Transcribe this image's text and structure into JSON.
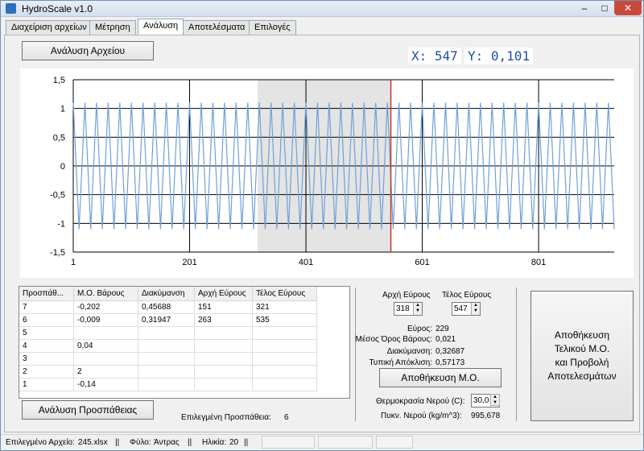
{
  "window": {
    "title": "HydroScale v1.0",
    "min": "–",
    "max": "□",
    "close": "✕"
  },
  "tabs": [
    "Διαχείριση αρχείων",
    "Μέτρηση",
    "Ανάλυση",
    "Αποτελέσματα",
    "Επιλογές"
  ],
  "active_tab": "Ανάλυση",
  "analyze_file_button": "Ανάλυση Αρχείου",
  "coords": {
    "x_label": "X:",
    "x_value": "547",
    "y_label": "Y:",
    "y_value": "0,101"
  },
  "chart_data": {
    "type": "line",
    "x_ticks": [
      "1",
      "201",
      "401",
      "601",
      "801"
    ],
    "y_ticks": [
      "1,5",
      "1",
      "0,5",
      "0",
      "-0,5",
      "-1",
      "-1,5"
    ],
    "xlim": [
      1,
      931
    ],
    "ylim": [
      -1.5,
      1.5
    ],
    "series": [
      {
        "color": "#6fa0d8",
        "amplitude": 1.1,
        "period_samples": 20
      }
    ],
    "selection_range": [
      318,
      547
    ],
    "cursor_x": 547,
    "grid": true
  },
  "table": {
    "headers": [
      "Προσπάθ...",
      "Μ.Ο. Βάρους",
      "Διακύμανση",
      "Αρχή Εύρους",
      "Τέλος Εύρους"
    ],
    "rows": [
      [
        "7",
        "-0,202",
        "0,45688",
        "151",
        "321"
      ],
      [
        "6",
        "-0,009",
        "0,31947",
        "263",
        "535"
      ],
      [
        "5",
        "",
        "",
        "",
        ""
      ],
      [
        "4",
        "0,04",
        "",
        "",
        ""
      ],
      [
        "3",
        "",
        "",
        "",
        ""
      ],
      [
        "2",
        "2",
        "",
        "",
        ""
      ],
      [
        "1",
        "-0,14",
        "",
        "",
        ""
      ]
    ]
  },
  "analyze_attempt_button": "Ανάλυση Προσπάθειας",
  "selected_attempt": {
    "label": "Επιλεγμένη Προσπάθεια:",
    "value": "6"
  },
  "range": {
    "start_label": "Αρχή Εύρους",
    "end_label": "Τέλος Εύρους",
    "start": "318",
    "end": "547"
  },
  "stats": {
    "range_label": "Εύρος:",
    "range_value": "229",
    "mean_label": "Μέσος Όρος Βάρους:",
    "mean_value": "0,021",
    "var_label": "Διακύμανση:",
    "var_value": "0,32687",
    "std_label": "Τυπική Απόκλιση:",
    "std_value": "0,57173"
  },
  "save_mean_button": "Αποθήκευση Μ.Ο.",
  "water_temp": {
    "label": "Θερμοκρασία Νερού (C):",
    "value": "30,0"
  },
  "water_density": {
    "label": "Πυκν. Νερού (kg/m^3):",
    "value": "995,678"
  },
  "save_final_button": [
    "Αποθήκευση",
    "Τελικού Μ.Ο.",
    "και Προβολή",
    "Αποτελεσμάτων"
  ],
  "statusbar": {
    "file_label": "Επιλεγμένο Αρχείο:",
    "file_value": "245.xlsx",
    "sex_label": "Φύλο:",
    "sex_value": "Άντρας",
    "age_label": "Ηλικία:",
    "age_value": "20",
    "sep": "||",
    "disabled_buttons": [
      "",
      "",
      ""
    ]
  }
}
